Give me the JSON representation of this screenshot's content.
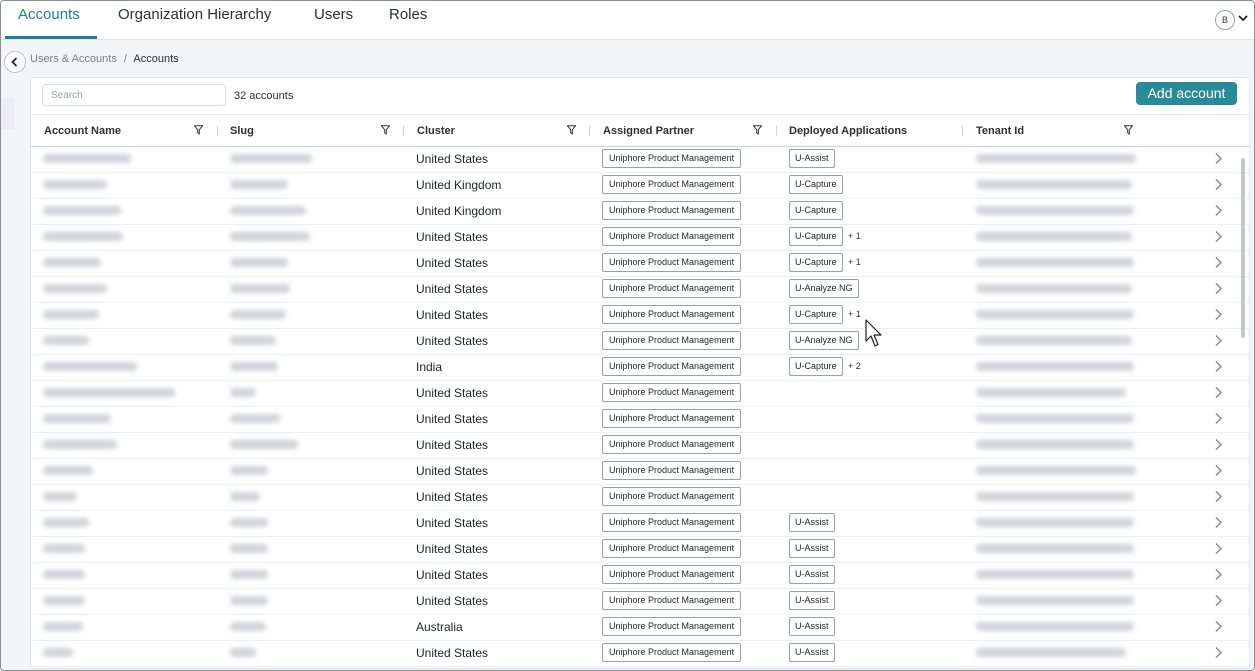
{
  "tabs": [
    {
      "label": "Accounts",
      "active": true
    },
    {
      "label": "Organization Hierarchy",
      "active": false
    },
    {
      "label": "Users",
      "active": false
    },
    {
      "label": "Roles",
      "active": false
    }
  ],
  "user": {
    "initial": "B"
  },
  "breadcrumb": {
    "parent": "Users & Accounts",
    "separator": "/",
    "current": "Accounts"
  },
  "toolbar": {
    "search_placeholder": "Search",
    "count": "32 accounts",
    "add_label": "Add account"
  },
  "columns": [
    "Account Name",
    "Slug",
    "Cluster",
    "Assigned Partner",
    "Deployed Applications",
    "Tenant Id"
  ],
  "colors": {
    "accent": "#1f7f8c",
    "button": "#2a8a95"
  },
  "rows": [
    {
      "cluster": "United States",
      "partner": "Uniphore Product Management",
      "app": "U-Assist",
      "more": ""
    },
    {
      "cluster": "United Kingdom",
      "partner": "Uniphore Product Management",
      "app": "U-Capture",
      "more": ""
    },
    {
      "cluster": "United Kingdom",
      "partner": "Uniphore Product Management",
      "app": "U-Capture",
      "more": ""
    },
    {
      "cluster": "United States",
      "partner": "Uniphore Product Management",
      "app": "U-Capture",
      "more": "+ 1"
    },
    {
      "cluster": "United States",
      "partner": "Uniphore Product Management",
      "app": "U-Capture",
      "more": "+ 1"
    },
    {
      "cluster": "United States",
      "partner": "Uniphore Product Management",
      "app": "U-Analyze NG",
      "more": ""
    },
    {
      "cluster": "United States",
      "partner": "Uniphore Product Management",
      "app": "U-Capture",
      "more": "+ 1"
    },
    {
      "cluster": "United States",
      "partner": "Uniphore Product Management",
      "app": "U-Analyze NG",
      "more": ""
    },
    {
      "cluster": "India",
      "partner": "Uniphore Product Management",
      "app": "U-Capture",
      "more": "+ 2"
    },
    {
      "cluster": "United States",
      "partner": "Uniphore Product Management",
      "app": "",
      "more": ""
    },
    {
      "cluster": "United States",
      "partner": "Uniphore Product Management",
      "app": "",
      "more": ""
    },
    {
      "cluster": "United States",
      "partner": "Uniphore Product Management",
      "app": "",
      "more": ""
    },
    {
      "cluster": "United States",
      "partner": "Uniphore Product Management",
      "app": "",
      "more": ""
    },
    {
      "cluster": "United States",
      "partner": "Uniphore Product Management",
      "app": "",
      "more": ""
    },
    {
      "cluster": "United States",
      "partner": "Uniphore Product Management",
      "app": "U-Assist",
      "more": ""
    },
    {
      "cluster": "United States",
      "partner": "Uniphore Product Management",
      "app": "U-Assist",
      "more": ""
    },
    {
      "cluster": "United States",
      "partner": "Uniphore Product Management",
      "app": "U-Assist",
      "more": ""
    },
    {
      "cluster": "United States",
      "partner": "Uniphore Product Management",
      "app": "U-Assist",
      "more": ""
    },
    {
      "cluster": "Australia",
      "partner": "Uniphore Product Management",
      "app": "U-Assist",
      "more": ""
    },
    {
      "cluster": "United States",
      "partner": "Uniphore Product Management",
      "app": "U-Assist",
      "more": ""
    }
  ]
}
